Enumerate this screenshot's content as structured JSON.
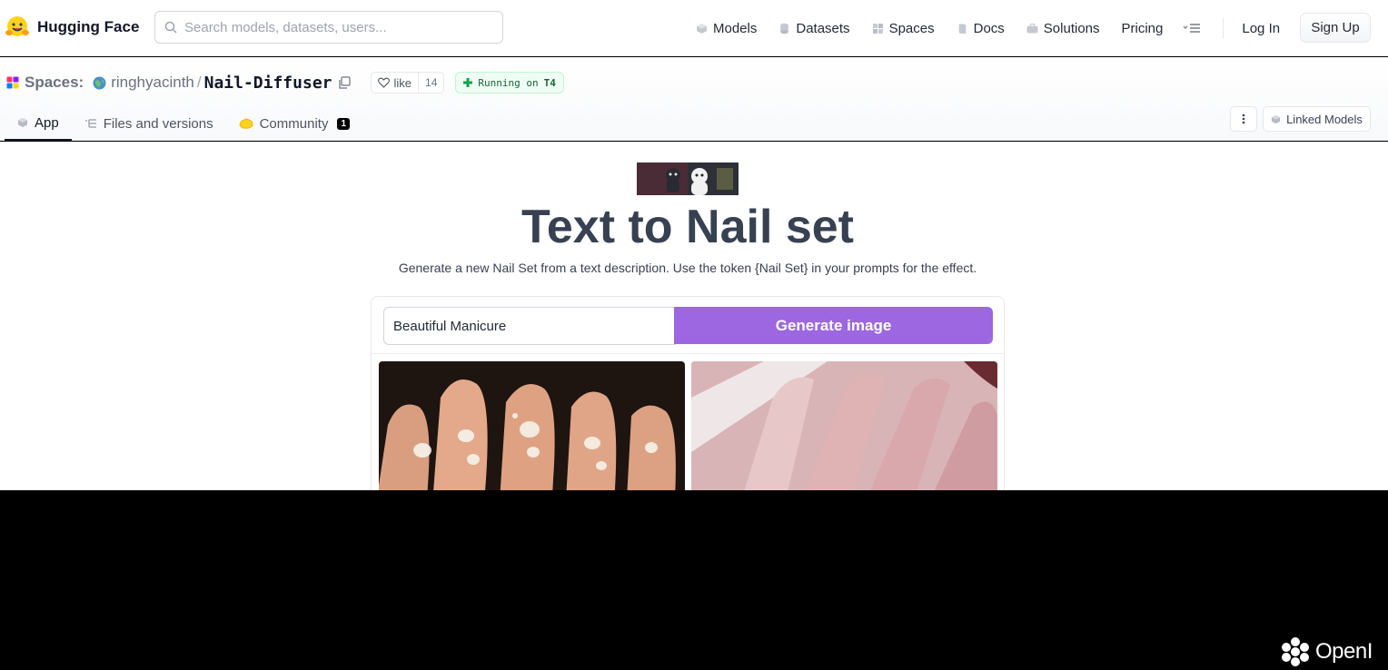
{
  "header": {
    "brand": "Hugging Face",
    "search_placeholder": "Search models, datasets, users...",
    "nav": [
      "Models",
      "Datasets",
      "Spaces",
      "Docs",
      "Solutions",
      "Pricing"
    ],
    "login": "Log In",
    "signup": "Sign Up"
  },
  "space": {
    "section_label": "Spaces:",
    "owner": "ringhyacinth",
    "separator": "/",
    "repo": "Nail-Diffuser",
    "like_label": "like",
    "like_count": "14",
    "status_text": "Running on",
    "hardware": "T4",
    "tabs": {
      "app": "App",
      "files": "Files and versions",
      "community": "Community",
      "community_count": "1"
    },
    "linked_models": "Linked Models"
  },
  "app": {
    "title": "Text to Nail set",
    "description": "Generate a new Nail Set from a text description. Use the token {Nail Set} in your prompts for the effect.",
    "prompt_value": "Beautiful Manicure",
    "generate_label": "Generate image"
  },
  "watermark": "OpenI",
  "colors": {
    "generate_button": "#9c67e0",
    "title_text": "#374151",
    "status_green": "#166534"
  },
  "icons": {
    "models": "cube-icon",
    "datasets": "database-icon",
    "spaces": "grid-icon",
    "docs": "book-icon",
    "solutions": "briefcase-icon"
  }
}
